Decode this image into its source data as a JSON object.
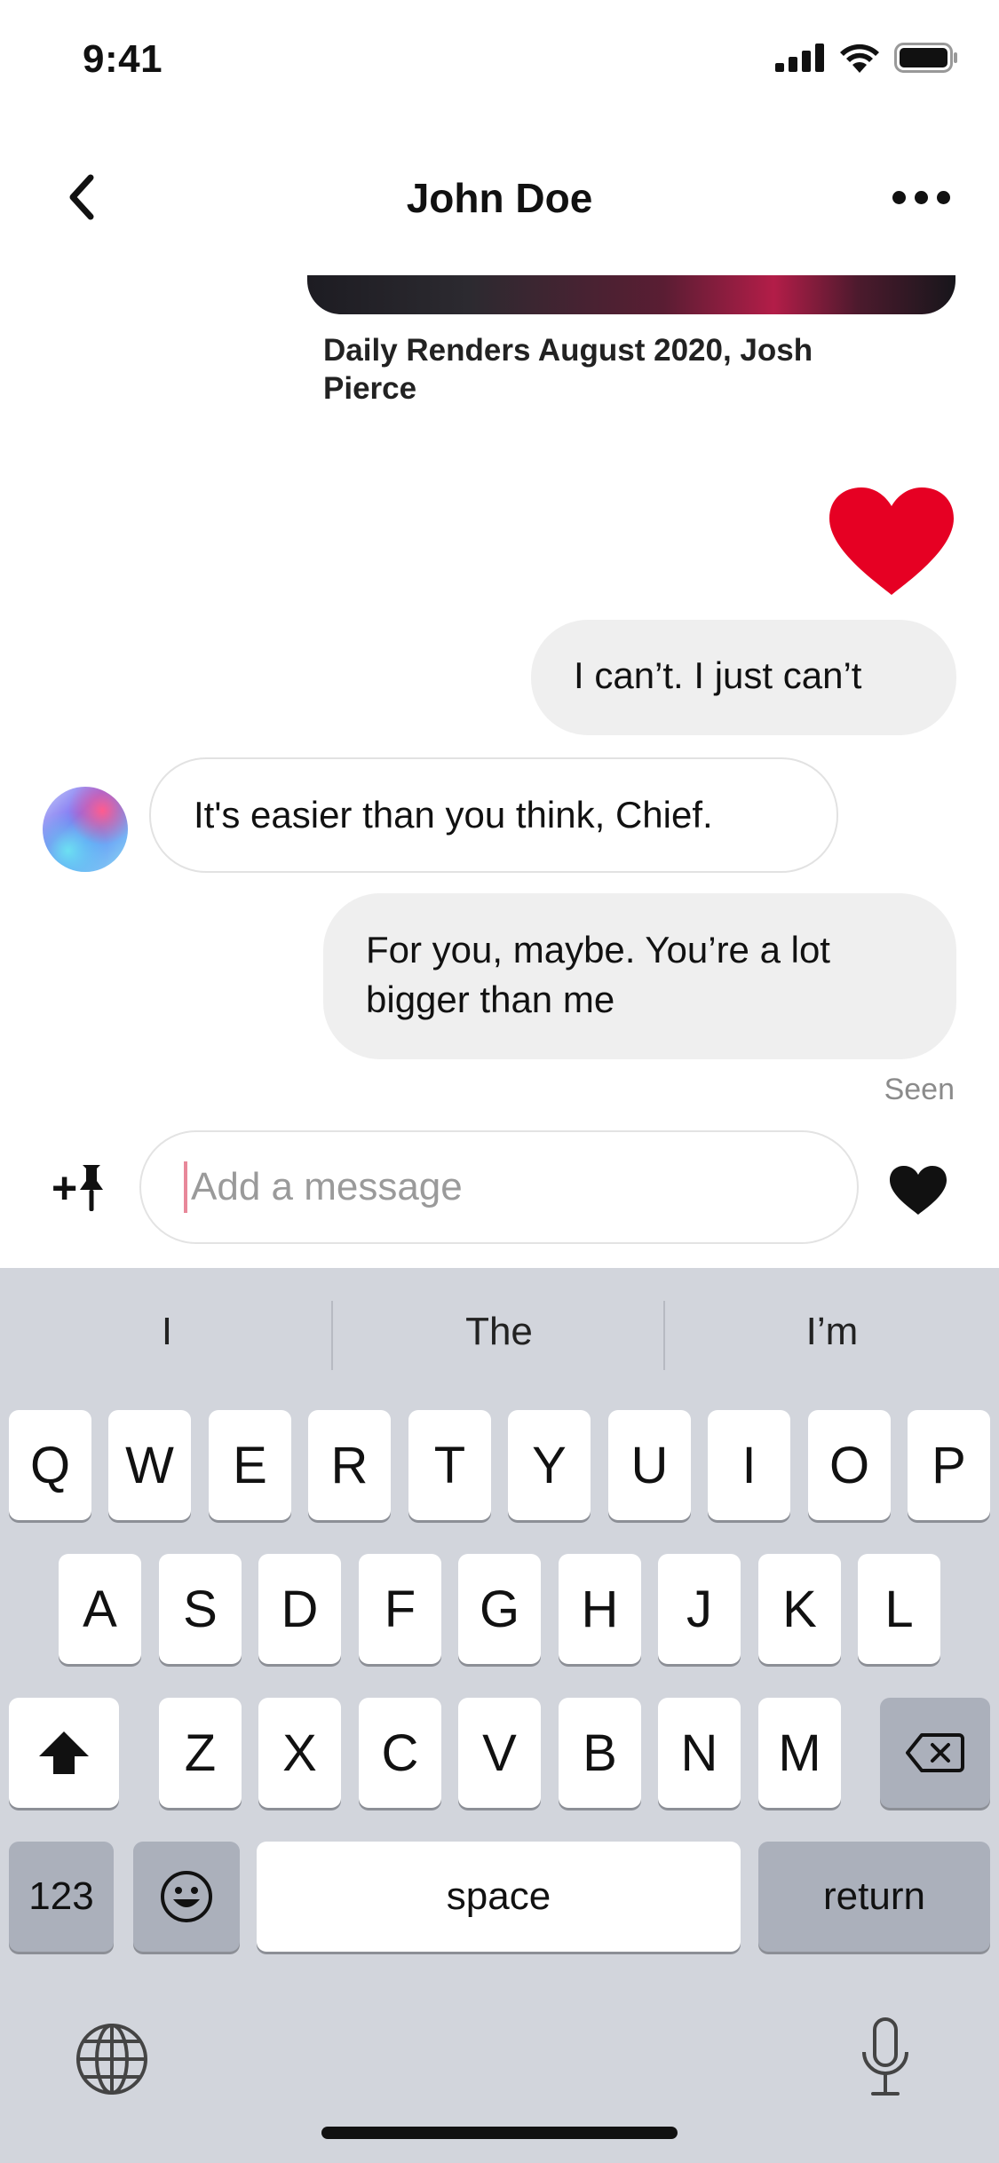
{
  "status_bar": {
    "time": "9:41"
  },
  "header": {
    "title": "John Doe"
  },
  "shared_post": {
    "caption": "Daily Renders August 2020, Josh Pierce"
  },
  "messages": [
    {
      "text": "I can’t. I just can’t"
    },
    {
      "text": "It's easier than you think, Chief."
    },
    {
      "text": "For you, maybe. You’re a lot bigger than me"
    }
  ],
  "seen_label": "Seen",
  "composer": {
    "placeholder": "Add a message",
    "add_pin_plus": "+"
  },
  "colors": {
    "like_red": "#e60023",
    "keyboard_bg": "#d2d5dc"
  },
  "keyboard": {
    "suggestions": [
      "I",
      "The",
      "I’m"
    ],
    "row1": [
      "Q",
      "W",
      "E",
      "R",
      "T",
      "Y",
      "U",
      "I",
      "O",
      "P"
    ],
    "row2": [
      "A",
      "S",
      "D",
      "F",
      "G",
      "H",
      "J",
      "K",
      "L"
    ],
    "row3": [
      "Z",
      "X",
      "C",
      "V",
      "B",
      "N",
      "M"
    ],
    "numbers_label": "123",
    "space_label": "space",
    "return_label": "return"
  }
}
